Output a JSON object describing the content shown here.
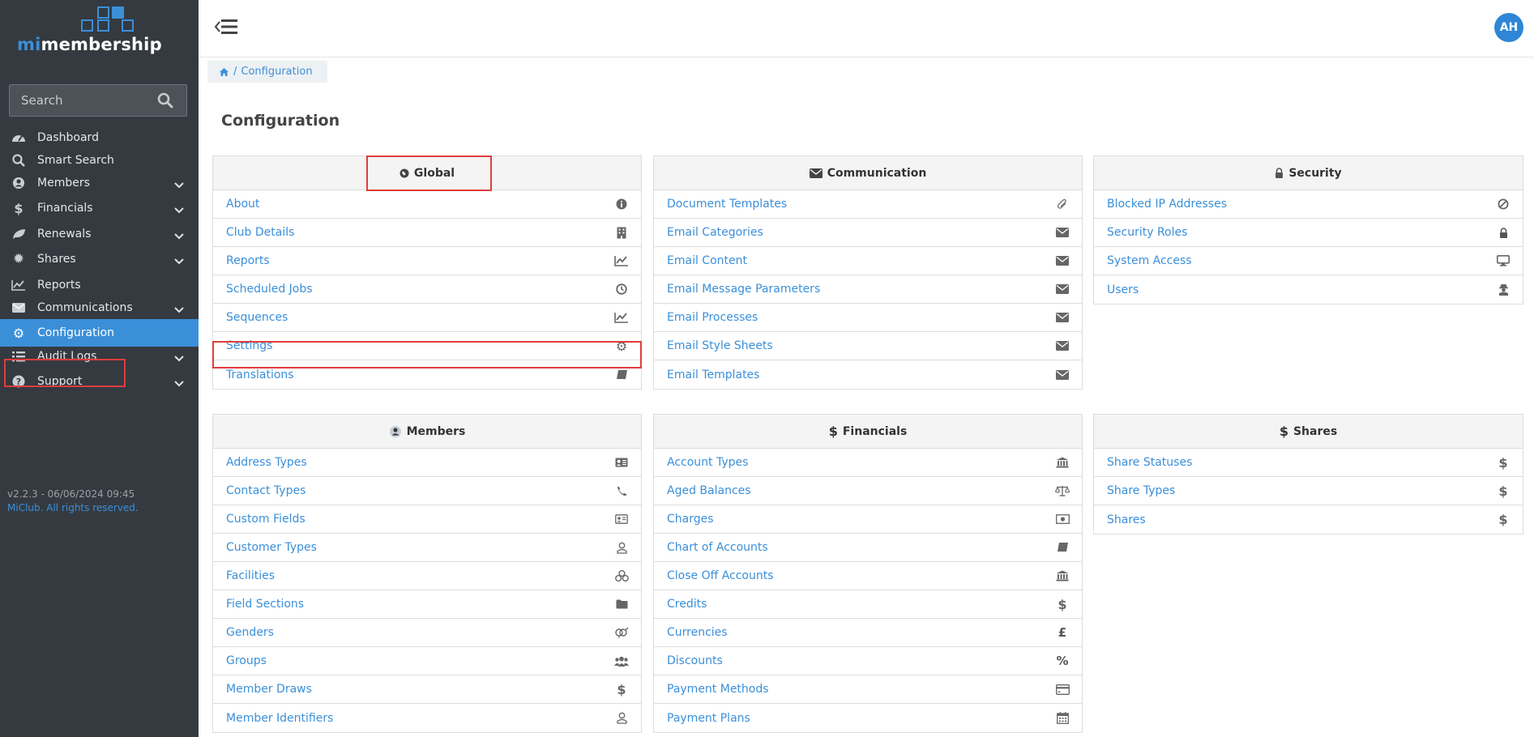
{
  "brand": {
    "prefix": "mi",
    "name": "membership"
  },
  "search": {
    "placeholder": "Search"
  },
  "nav": [
    {
      "label": "Dashboard",
      "icon": "dashboard-icon",
      "chevron": false
    },
    {
      "label": "Smart Search",
      "icon": "search-icon",
      "chevron": false
    },
    {
      "label": "Members",
      "icon": "user-circle-icon",
      "chevron": true
    },
    {
      "label": "Financials",
      "icon": "dollar-icon",
      "chevron": true
    },
    {
      "label": "Renewals",
      "icon": "leaf-icon",
      "chevron": true
    },
    {
      "label": "Shares",
      "icon": "cog-icon",
      "chevron": true
    },
    {
      "label": "Reports",
      "icon": "line-chart-icon",
      "chevron": false
    },
    {
      "label": "Communications",
      "icon": "envelope-icon",
      "chevron": true
    },
    {
      "label": "Configuration",
      "icon": "gear-icon",
      "chevron": false,
      "active": true
    },
    {
      "label": "Audit Logs",
      "icon": "list-icon",
      "chevron": true
    },
    {
      "label": "Support",
      "icon": "question-icon",
      "chevron": true
    }
  ],
  "footer": {
    "version": "v2.2.3 - 06/06/2024 09:45",
    "rights": "MiClub. All rights reserved."
  },
  "user": {
    "initials": "AH"
  },
  "breadcrumb": {
    "current": "Configuration"
  },
  "page": {
    "title": "Configuration"
  },
  "panels": {
    "global": {
      "title": "Global",
      "icon": "globe-icon",
      "items": [
        {
          "label": "About",
          "icon": "info-icon"
        },
        {
          "label": "Club Details",
          "icon": "building-icon"
        },
        {
          "label": "Reports",
          "icon": "line-chart-icon"
        },
        {
          "label": "Scheduled Jobs",
          "icon": "clock-icon"
        },
        {
          "label": "Sequences",
          "icon": "line-chart-icon"
        },
        {
          "label": "Settings",
          "icon": "gear-icon"
        },
        {
          "label": "Translations",
          "icon": "book-icon"
        }
      ]
    },
    "communication": {
      "title": "Communication",
      "icon": "envelope-icon",
      "items": [
        {
          "label": "Document Templates",
          "icon": "paperclip-icon"
        },
        {
          "label": "Email Categories",
          "icon": "envelope-icon"
        },
        {
          "label": "Email Content",
          "icon": "envelope-icon"
        },
        {
          "label": "Email Message Parameters",
          "icon": "envelope-icon"
        },
        {
          "label": "Email Processes",
          "icon": "envelope-icon"
        },
        {
          "label": "Email Style Sheets",
          "icon": "envelope-icon"
        },
        {
          "label": "Email Templates",
          "icon": "envelope-icon"
        }
      ]
    },
    "security": {
      "title": "Security",
      "icon": "lock-icon",
      "items": [
        {
          "label": "Blocked IP Addresses",
          "icon": "ban-icon"
        },
        {
          "label": "Security Roles",
          "icon": "lock-icon"
        },
        {
          "label": "System Access",
          "icon": "desktop-icon"
        },
        {
          "label": "Users",
          "icon": "user-secret-icon"
        }
      ]
    },
    "members": {
      "title": "Members",
      "icon": "user-circle-icon",
      "items": [
        {
          "label": "Address Types",
          "icon": "address-card-icon"
        },
        {
          "label": "Contact Types",
          "icon": "phone-icon"
        },
        {
          "label": "Custom Fields",
          "icon": "id-card-icon"
        },
        {
          "label": "Customer Types",
          "icon": "user-outline-icon"
        },
        {
          "label": "Facilities",
          "icon": "cubes-icon"
        },
        {
          "label": "Field Sections",
          "icon": "folder-icon"
        },
        {
          "label": "Genders",
          "icon": "genderless-icon"
        },
        {
          "label": "Groups",
          "icon": "users-icon"
        },
        {
          "label": "Member Draws",
          "icon": "dollar-icon"
        },
        {
          "label": "Member Identifiers",
          "icon": "user-outline-icon"
        }
      ]
    },
    "financials": {
      "title": "Financials",
      "icon": "dollar-icon",
      "items": [
        {
          "label": "Account Types",
          "icon": "bank-icon"
        },
        {
          "label": "Aged Balances",
          "icon": "balance-scale-icon"
        },
        {
          "label": "Charges",
          "icon": "money-icon"
        },
        {
          "label": "Chart of Accounts",
          "icon": "book-icon"
        },
        {
          "label": "Close Off Accounts",
          "icon": "bank-icon"
        },
        {
          "label": "Credits",
          "icon": "dollar-icon"
        },
        {
          "label": "Currencies",
          "icon": "gbp-icon"
        },
        {
          "label": "Discounts",
          "icon": "percent-icon"
        },
        {
          "label": "Payment Methods",
          "icon": "credit-card-icon"
        },
        {
          "label": "Payment Plans",
          "icon": "calendar-icon"
        }
      ]
    },
    "shares": {
      "title": "Shares",
      "icon": "dollar-icon",
      "items": [
        {
          "label": "Share Statuses",
          "icon": "dollar-icon"
        },
        {
          "label": "Share Types",
          "icon": "dollar-icon"
        },
        {
          "label": "Shares",
          "icon": "dollar-icon"
        }
      ]
    }
  },
  "colors": {
    "sidebar": "#343a40",
    "accent": "#3b8fd9",
    "highlight": "#e03c3c"
  }
}
